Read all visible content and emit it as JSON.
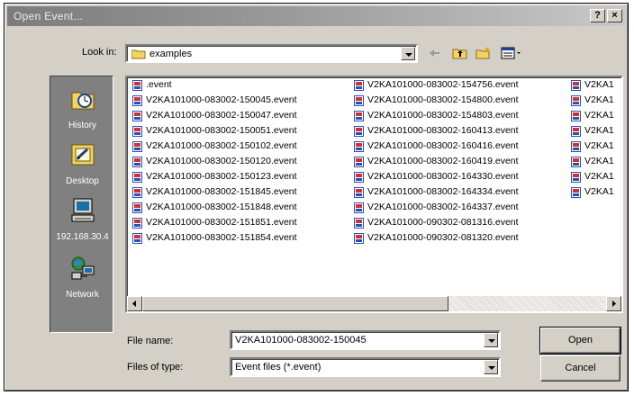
{
  "window": {
    "title": "Open Event..."
  },
  "titlebar_buttons": {
    "help": "?",
    "close": "×"
  },
  "look_in": {
    "label": "Look in:",
    "value": "examples"
  },
  "toolbar": [
    "back-icon",
    "up-folder-icon",
    "new-folder-icon",
    "view-menu-icon"
  ],
  "places": [
    {
      "label": "History",
      "icon": "history-icon"
    },
    {
      "label": "Desktop",
      "icon": "desktop-icon"
    },
    {
      "label": "192.168.30.4",
      "icon": "computer-icon"
    },
    {
      "label": "Network",
      "icon": "network-icon"
    }
  ],
  "files": {
    "col1": [
      ".event",
      "V2KA101000-083002-150045.event",
      "V2KA101000-083002-150047.event",
      "V2KA101000-083002-150051.event",
      "V2KA101000-083002-150102.event",
      "V2KA101000-083002-150120.event",
      "V2KA101000-083002-150123.event",
      "V2KA101000-083002-151845.event",
      "V2KA101000-083002-151848.event",
      "V2KA101000-083002-151851.event",
      "V2KA101000-083002-151854.event"
    ],
    "col2": [
      "V2KA101000-083002-154756.event",
      "V2KA101000-083002-154800.event",
      "V2KA101000-083002-154803.event",
      "V2KA101000-083002-160413.event",
      "V2KA101000-083002-160416.event",
      "V2KA101000-083002-160419.event",
      "V2KA101000-083002-164330.event",
      "V2KA101000-083002-164334.event",
      "V2KA101000-083002-164337.event",
      "V2KA101000-090302-081316.event",
      "V2KA101000-090302-081320.event"
    ],
    "col3": [
      "V2KA1",
      "V2KA1",
      "V2KA1",
      "V2KA1",
      "V2KA1",
      "V2KA1",
      "V2KA1",
      "V2KA1"
    ]
  },
  "file_name": {
    "label": "File name:",
    "value": "V2KA101000-083002-150045"
  },
  "file_type": {
    "label": "Files of type:",
    "value": "Event files (*.event)"
  },
  "buttons": {
    "open": "Open",
    "cancel": "Cancel"
  }
}
